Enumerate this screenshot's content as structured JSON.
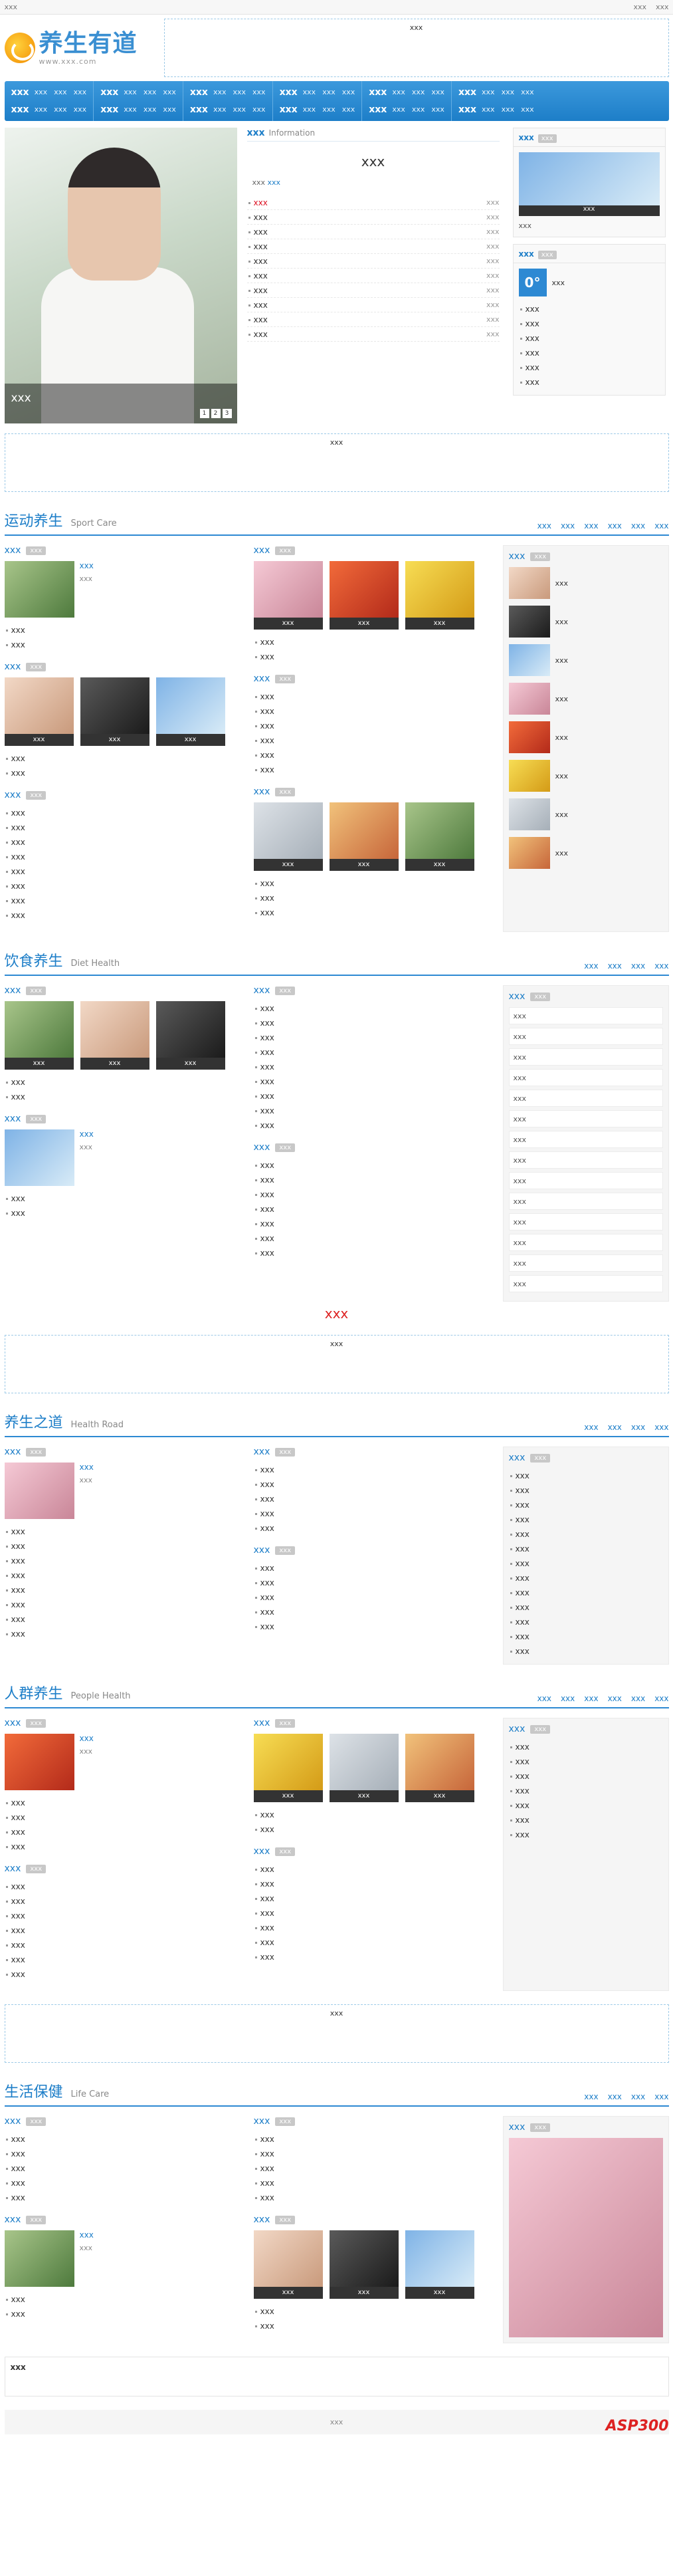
{
  "topbar": {
    "left": "xxx",
    "right1": "xxx",
    "right2": "xxx"
  },
  "logo": {
    "title": "养生有道",
    "sub": "www.xxx.com"
  },
  "ads": {
    "top": "xxx",
    "wide1": "xxx",
    "wide2": "xxx",
    "wide3": "xxx"
  },
  "nav": [
    {
      "main": [
        "xxx",
        "xxx"
      ],
      "subs": [
        "xxx",
        "xxx",
        "xxx",
        "xxx",
        "xxx",
        "xxx"
      ]
    },
    {
      "main": [
        "xxx",
        "xxx"
      ],
      "subs": [
        "xxx",
        "xxx",
        "xxx",
        "xxx",
        "xxx",
        "xxx"
      ]
    },
    {
      "main": [
        "xxx",
        "xxx"
      ],
      "subs": [
        "xxx",
        "xxx",
        "xxx",
        "xxx",
        "xxx",
        "xxx"
      ]
    },
    {
      "main": [
        "xxx",
        "xxx"
      ],
      "subs": [
        "xxx",
        "xxx",
        "xxx",
        "xxx",
        "xxx",
        "xxx"
      ]
    },
    {
      "main": [
        "xxx",
        "xxx"
      ],
      "subs": [
        "xxx",
        "xxx",
        "xxx",
        "xxx",
        "xxx",
        "xxx"
      ]
    },
    {
      "main": [
        "xxx",
        "xxx"
      ],
      "subs": [
        "xxx",
        "xxx",
        "xxx",
        "xxx",
        "xxx",
        "xxx"
      ]
    }
  ],
  "hero": {
    "caption": "xxx",
    "dots": [
      "1",
      "2",
      "3"
    ],
    "news_title": "xxx",
    "news_en": "Information",
    "headline": "xxx",
    "summary": "xxx",
    "more": "xxx",
    "items": [
      {
        "t": "xxx",
        "d": "xxx",
        "red": true
      },
      {
        "t": "xxx",
        "d": "xxx"
      },
      {
        "t": "xxx",
        "d": "xxx"
      },
      {
        "t": "xxx",
        "d": "xxx"
      },
      {
        "t": "xxx",
        "d": "xxx"
      },
      {
        "t": "xxx",
        "d": "xxx"
      },
      {
        "t": "xxx",
        "d": "xxx"
      },
      {
        "t": "xxx",
        "d": "xxx"
      },
      {
        "t": "xxx",
        "d": "xxx"
      },
      {
        "t": "xxx",
        "d": "xxx"
      }
    ],
    "side1_title": "xxx",
    "side1_tag": "xxx",
    "side1_pic": "xxx",
    "side1_text": "xxx",
    "side2_title": "xxx",
    "side2_tag": "xxx",
    "side2_items": [
      "xxx",
      "xxx",
      "xxx",
      "xxx",
      "xxx",
      "xxx",
      "xxx"
    ]
  },
  "watermark": "xxx",
  "cats": [
    {
      "title": "运动养生",
      "en": "Sport Care",
      "links": [
        "xxx",
        "xxx",
        "xxx",
        "xxx",
        "xxx",
        "xxx"
      ],
      "a": [
        {
          "h": "xxx",
          "tag": "xxx",
          "ft": "xxx",
          "fs": "xxx",
          "list": [
            "xxx",
            "xxx"
          ]
        },
        {
          "h": "xxx",
          "tag": "xxx",
          "thumbs": [
            "xxx",
            "xxx",
            "xxx"
          ],
          "list": [
            "xxx",
            "xxx"
          ]
        },
        {
          "h": "xxx",
          "tag": "xxx",
          "list": [
            "xxx",
            "xxx",
            "xxx",
            "xxx",
            "xxx",
            "xxx",
            "xxx",
            "xxx"
          ]
        }
      ],
      "b": [
        {
          "h": "xxx",
          "tag": "xxx",
          "thumbs": [
            "xxx",
            "xxx",
            "xxx"
          ],
          "list": [
            "xxx",
            "xxx"
          ]
        },
        {
          "h": "xxx",
          "tag": "xxx",
          "list": [
            "xxx",
            "xxx",
            "xxx",
            "xxx",
            "xxx",
            "xxx"
          ]
        },
        {
          "h": "xxx",
          "tag": "xxx",
          "thumbs": [
            "xxx",
            "xxx",
            "xxx"
          ],
          "list": [
            "xxx",
            "xxx",
            "xxx"
          ]
        }
      ],
      "c": {
        "h": "xxx",
        "tag": "xxx",
        "items": [
          "xxx",
          "xxx",
          "xxx",
          "xxx",
          "xxx",
          "xxx",
          "xxx",
          "xxx"
        ]
      }
    },
    {
      "title": "饮食养生",
      "en": "Diet Health",
      "links": [
        "xxx",
        "xxx",
        "xxx",
        "xxx"
      ],
      "a": [
        {
          "h": "xxx",
          "tag": "xxx",
          "thumbs": [
            "xxx",
            "xxx",
            "xxx"
          ],
          "list": [
            "xxx",
            "xxx"
          ]
        },
        {
          "h": "xxx",
          "tag": "xxx",
          "ft": "xxx",
          "fs": "xxx",
          "list": [
            "xxx",
            "xxx"
          ]
        }
      ],
      "b": [
        {
          "h": "xxx",
          "tag": "xxx",
          "list": [
            "xxx",
            "xxx",
            "xxx",
            "xxx",
            "xxx",
            "xxx",
            "xxx",
            "xxx",
            "xxx"
          ]
        },
        {
          "h": "xxx",
          "tag": "xxx",
          "list": [
            "xxx",
            "xxx",
            "xxx",
            "xxx",
            "xxx",
            "xxx",
            "xxx"
          ]
        }
      ],
      "c": {
        "h": "xxx",
        "tag": "xxx",
        "tags": [
          "xxx",
          "xxx",
          "xxx",
          "xxx",
          "xxx",
          "xxx",
          "xxx",
          "xxx",
          "xxx",
          "xxx",
          "xxx",
          "xxx",
          "xxx",
          "xxx"
        ]
      }
    },
    {
      "title": "养生之道",
      "en": "Health Road",
      "links": [
        "xxx",
        "xxx",
        "xxx",
        "xxx"
      ],
      "a": [
        {
          "h": "xxx",
          "tag": "xxx",
          "ft": "xxx",
          "fs": "xxx",
          "list": [
            "xxx",
            "xxx",
            "xxx",
            "xxx",
            "xxx",
            "xxx",
            "xxx",
            "xxx"
          ]
        }
      ],
      "b": [
        {
          "h": "xxx",
          "tag": "xxx",
          "list": [
            "xxx",
            "xxx",
            "xxx",
            "xxx",
            "xxx"
          ]
        },
        {
          "h": "xxx",
          "tag": "xxx",
          "list": [
            "xxx",
            "xxx",
            "xxx",
            "xxx",
            "xxx"
          ]
        }
      ],
      "c": {
        "h": "xxx",
        "tag": "xxx",
        "list": [
          "xxx",
          "xxx",
          "xxx",
          "xxx",
          "xxx",
          "xxx",
          "xxx",
          "xxx",
          "xxx",
          "xxx",
          "xxx",
          "xxx",
          "xxx"
        ]
      }
    },
    {
      "title": "人群养生",
      "en": "People Health",
      "links": [
        "xxx",
        "xxx",
        "xxx",
        "xxx",
        "xxx",
        "xxx"
      ],
      "a": [
        {
          "h": "xxx",
          "tag": "xxx",
          "ft": "xxx",
          "fs": "xxx",
          "list": [
            "xxx",
            "xxx",
            "xxx",
            "xxx"
          ]
        },
        {
          "h": "xxx",
          "tag": "xxx",
          "list": [
            "xxx",
            "xxx",
            "xxx",
            "xxx",
            "xxx",
            "xxx",
            "xxx"
          ]
        }
      ],
      "b": [
        {
          "h": "xxx",
          "tag": "xxx",
          "thumbs": [
            "xxx",
            "xxx",
            "xxx"
          ],
          "list": [
            "xxx",
            "xxx"
          ]
        },
        {
          "h": "xxx",
          "tag": "xxx",
          "list": [
            "xxx",
            "xxx",
            "xxx",
            "xxx",
            "xxx",
            "xxx",
            "xxx"
          ]
        }
      ],
      "c": {
        "h": "xxx",
        "tag": "xxx",
        "list": [
          "xxx",
          "xxx",
          "xxx",
          "xxx",
          "xxx",
          "xxx",
          "xxx"
        ]
      }
    },
    {
      "title": "生活保健",
      "en": "Life Care",
      "links": [
        "xxx",
        "xxx",
        "xxx",
        "xxx"
      ],
      "a": [
        {
          "h": "xxx",
          "tag": "xxx",
          "list": [
            "xxx",
            "xxx",
            "xxx",
            "xxx",
            "xxx"
          ]
        },
        {
          "h": "xxx",
          "tag": "xxx",
          "ft": "xxx",
          "fs": "xxx",
          "list": [
            "xxx",
            "xxx"
          ]
        }
      ],
      "b": [
        {
          "h": "xxx",
          "tag": "xxx",
          "list": [
            "xxx",
            "xxx",
            "xxx",
            "xxx",
            "xxx"
          ]
        },
        {
          "h": "xxx",
          "tag": "xxx",
          "thumbs": [
            "xxx",
            "xxx",
            "xxx"
          ],
          "list": [
            "xxx",
            "xxx"
          ]
        }
      ],
      "c": {
        "h": "xxx",
        "tag": "xxx"
      }
    }
  ],
  "friend": {
    "title": "xxx"
  },
  "footer": "xxx",
  "asp": "ASP300"
}
